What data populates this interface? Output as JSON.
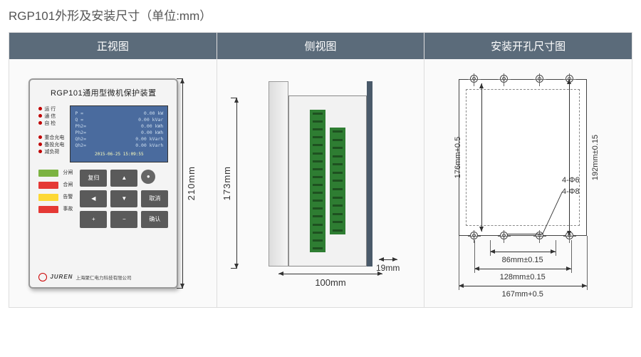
{
  "title": "RGP101外形及安装尺寸（单位:mm）",
  "colors": {
    "header_bg": "#5b6b7a",
    "lcd_bg": "#4a6b9e",
    "connector": "#2e7d32"
  },
  "panels": {
    "front": {
      "header": "正视图"
    },
    "side": {
      "header": "侧视图"
    },
    "cutout": {
      "header": "安装开孔尺寸图"
    }
  },
  "front": {
    "device_title": "RGP101通用型微机保护装置",
    "leds_top": [
      "运 行",
      "通 信",
      "自 检"
    ],
    "leds_bottom": [
      "重合允电",
      "备投允电",
      "减负荷"
    ],
    "lcd_rows": [
      {
        "l": "P =",
        "r": "0.00 kW"
      },
      {
        "l": "Q =",
        "r": "0.00 kVar"
      },
      {
        "l": "Ph2=",
        "r": "0.00 kWh"
      },
      {
        "l": "Ph2=",
        "r": "0.00 kWh"
      },
      {
        "l": "Qh2=",
        "r": "0.00 kVarh"
      },
      {
        "l": "Qh2=",
        "r": "0.00 kVarh"
      }
    ],
    "lcd_datetime": "2015-06-25  15:09:55",
    "push_buttons": [
      {
        "color": "gr",
        "label": "分闸"
      },
      {
        "color": "rd",
        "label": "合闸"
      },
      {
        "color": "ye",
        "label": "告警"
      },
      {
        "color": "rd",
        "label": "事故"
      }
    ],
    "keys": [
      "复归",
      "▲",
      "●",
      "◀",
      "▼",
      "取消",
      "+",
      "−",
      "确认"
    ],
    "brand": {
      "en": "JUREN",
      "cn": "上海聚仁电力科技有限公司"
    },
    "dim_height": "210mm"
  },
  "side": {
    "dim_height": "173mm",
    "dim_width": "100mm",
    "dim_front_thickness": "19mm"
  },
  "cutout": {
    "dim_v_inner": "176mm+0.5",
    "dim_v_outer": "192mm±0.15",
    "hole_notes": [
      "4-Φ6",
      "4-Φ8"
    ],
    "dim_h_1": "86mm±0.15",
    "dim_h_2": "128mm±0.15",
    "dim_h_3": "167mm+0.5"
  }
}
